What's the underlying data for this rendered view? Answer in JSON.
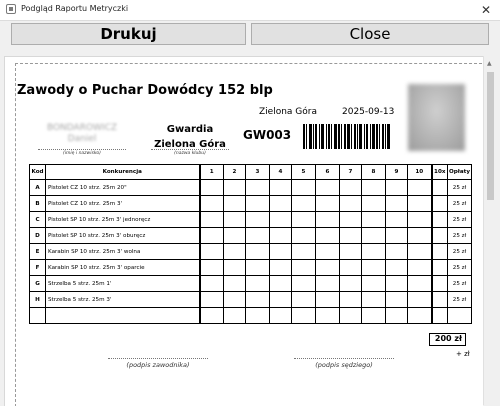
{
  "window": {
    "title": "Podgląd Raportu Metryczki",
    "close_glyph": "✕"
  },
  "toolbar": {
    "print_label": "Drukuj",
    "close_label": "Close"
  },
  "report": {
    "title": "Zawody o Puchar Dowódcy 152 blp",
    "city": "Zielona Góra",
    "date": "2025-09-13",
    "competitor_name_line1": "BONDAROWICZ",
    "competitor_name_line2": "Daniel",
    "name_caption": "(imię i nazwisko)",
    "club": "Gwardia Zielona Góra",
    "club_caption": "(nazwa klubu)",
    "code": "GW003",
    "total": "200 zł",
    "plus": "+ zł",
    "signature_competitor": "(podpis zawodnika)",
    "signature_judge": "(podpis sędziego)"
  },
  "table": {
    "headers": [
      "Kod",
      "Konkurencja",
      "1",
      "2",
      "3",
      "4",
      "5",
      "6",
      "7",
      "8",
      "9",
      "10",
      "10x",
      "Opłaty"
    ],
    "rows": [
      {
        "kod": "A",
        "konkurencja": "Pistolet CZ 10 strz. 25m 20\"",
        "oplata": "25 zł"
      },
      {
        "kod": "B",
        "konkurencja": "Pistolet CZ 10 strz. 25m 3'",
        "oplata": "25 zł"
      },
      {
        "kod": "C",
        "konkurencja": "Pistolet SP 10 strz. 25m 3' jednoręcz",
        "oplata": "25 zł"
      },
      {
        "kod": "D",
        "konkurencja": "Pistolet SP 10 strz. 25m 3' oburęcz",
        "oplata": "25 zł"
      },
      {
        "kod": "E",
        "konkurencja": "Karabin SP 10 strz. 25m 3' wolna",
        "oplata": "25 zł"
      },
      {
        "kod": "F",
        "konkurencja": "Karabin SP 10 strz. 25m 3' oparcie",
        "oplata": "25 zł"
      },
      {
        "kod": "G",
        "konkurencja": "Strzelba 5 strz. 25m 1'",
        "oplata": "25 zł"
      },
      {
        "kod": "H",
        "konkurencja": "Strzelba 5 strz. 25m 3'",
        "oplata": "25 zł"
      },
      {
        "kod": "",
        "konkurencja": "",
        "oplata": ""
      }
    ]
  },
  "icons": {
    "app": "window-app-icon",
    "close": "close-icon",
    "scroll_up": "scroll-up-arrow-icon"
  }
}
